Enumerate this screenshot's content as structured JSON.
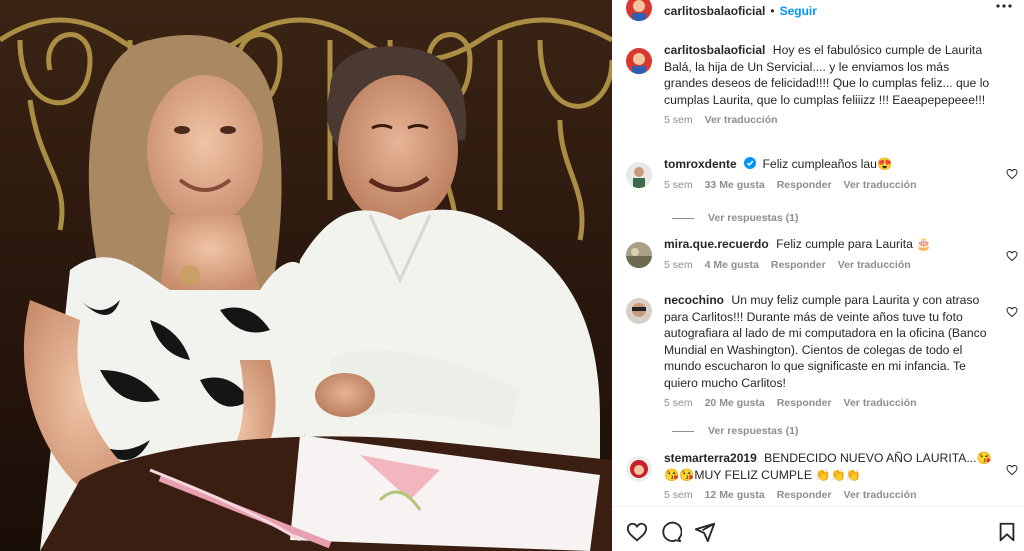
{
  "post": {
    "username": "carlitosbalaoficial",
    "follow_label": "Seguir",
    "separator": "•"
  },
  "caption": {
    "username": "carlitosbalaoficial",
    "text": "Hoy es el fabulósico cumple de Laurita Balá, la hija de Un Servicial.... y le enviamos los más grandes deseos de felicidad!!!! Que lo cumplas feliz... que lo cumplas Laurita, que lo cumplas feliiizz !!! Eaeapepepeee!!!",
    "time": "5 sem",
    "translate": "Ver traducción"
  },
  "comments": [
    {
      "username": "tomroxdente",
      "verified": true,
      "text": "Feliz cumpleaños lau😍",
      "time": "5 sem",
      "likes": "33 Me gusta",
      "reply": "Responder",
      "translate": "Ver traducción",
      "replies": "Ver respuestas (1)"
    },
    {
      "username": "mira.que.recuerdo",
      "text": "Feliz cumple para Laurita 🎂",
      "time": "5 sem",
      "likes": "4 Me gusta",
      "reply": "Responder",
      "translate": "Ver traducción"
    },
    {
      "username": "necochino",
      "text": "Un muy feliz cumple para Laurita y con atraso para Carlitos!!! Durante más de veinte años tuve tu foto autografiara al lado de mi computadora en la oficina (Banco Mundial en Washington). Cientos de colegas de todo el mundo escucharon lo que significaste en mi infancia. Te quiero mucho Carlitos!",
      "time": "5 sem",
      "likes": "20 Me gusta",
      "reply": "Responder",
      "translate": "Ver traducción",
      "replies": "Ver respuestas (1)"
    },
    {
      "username": "stemarterra2019",
      "text": "BENDECIDO NUEVO AÑO LAURITA...😘😘😘MUY FELIZ CUMPLE 👏👏👏",
      "time": "5 sem",
      "likes": "12 Me gusta",
      "reply": "Responder",
      "translate": "Ver traducción"
    }
  ],
  "icons": {
    "more": "more-options-icon",
    "heart": "heart-icon",
    "comment": "comment-icon",
    "share": "share-icon",
    "save": "bookmark-icon",
    "verified": "verified-badge-icon"
  },
  "colors": {
    "accent": "#0095f6",
    "muted": "#8e8e8e",
    "text": "#262626"
  }
}
